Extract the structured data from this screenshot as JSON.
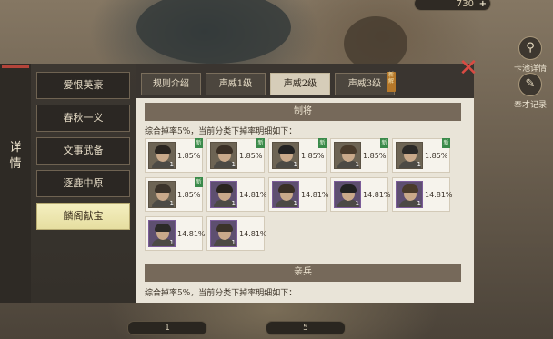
{
  "top_resource": {
    "value": "730",
    "plus": "+"
  },
  "side_buttons": [
    {
      "label": "卡池详情",
      "icon": "magnifier-icon",
      "glyph": "⚲"
    },
    {
      "label": "奉才记录",
      "icon": "scroll-icon",
      "glyph": "✎"
    }
  ],
  "bottom_pills": [
    "1",
    "5"
  ],
  "panel": {
    "side_tab_label": "详情",
    "nav_items": [
      {
        "label": "爱恨英豪",
        "active": false
      },
      {
        "label": "春秋一义",
        "active": false
      },
      {
        "label": "文事武备",
        "active": false
      },
      {
        "label": "逐鹿中原",
        "active": false
      },
      {
        "label": "麟阁献宝",
        "active": true
      }
    ],
    "tabs": [
      {
        "label": "规则介绍",
        "active": false
      },
      {
        "label": "声威1级",
        "active": false
      },
      {
        "label": "声威2级",
        "active": true
      },
      {
        "label": "声威3级",
        "active": false
      }
    ],
    "tab_badge": "新解",
    "sections": [
      {
        "title": "制将",
        "description": "综合掉率5%，当前分类下掉率明细如下：",
        "cards": [
          {
            "rate": "1.85%",
            "level": "1",
            "new_tag": "新",
            "quality": "normal"
          },
          {
            "rate": "1.85%",
            "level": "1",
            "new_tag": "新",
            "quality": "normal"
          },
          {
            "rate": "1.85%",
            "level": "1",
            "new_tag": "新",
            "quality": "normal"
          },
          {
            "rate": "1.85%",
            "level": "1",
            "new_tag": "新",
            "quality": "normal"
          },
          {
            "rate": "1.85%",
            "level": "1",
            "new_tag": "新",
            "quality": "normal"
          },
          {
            "rate": "1.85%",
            "level": "1",
            "new_tag": "新",
            "quality": "normal"
          },
          {
            "rate": "14.81%",
            "level": "1",
            "new_tag": "",
            "quality": "purple"
          },
          {
            "rate": "14.81%",
            "level": "1",
            "new_tag": "",
            "quality": "purple"
          },
          {
            "rate": "14.81%",
            "level": "1",
            "new_tag": "",
            "quality": "purple"
          },
          {
            "rate": "14.81%",
            "level": "1",
            "new_tag": "",
            "quality": "purple"
          },
          {
            "rate": "14.81%",
            "level": "1",
            "new_tag": "",
            "quality": "purple"
          },
          {
            "rate": "14.81%",
            "level": "1",
            "new_tag": "",
            "quality": "purple"
          }
        ]
      },
      {
        "title": "亲兵",
        "description": "综合掉率5%，当前分类下掉率明细如下：",
        "cards": []
      }
    ]
  }
}
